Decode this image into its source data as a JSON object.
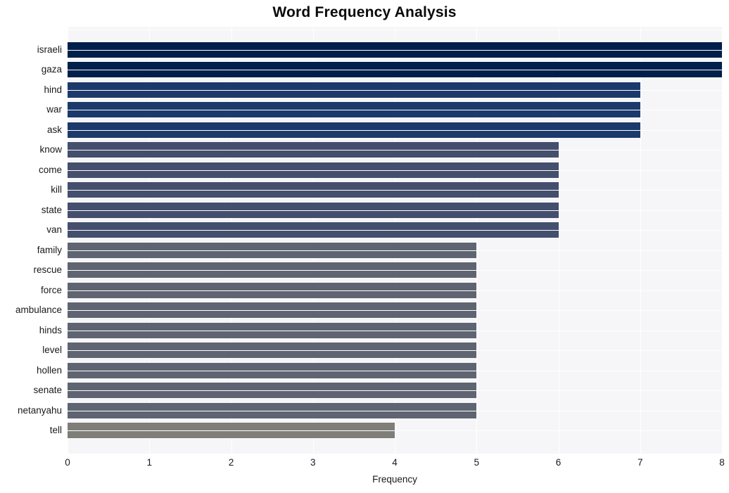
{
  "chart_data": {
    "type": "bar",
    "orientation": "horizontal",
    "title": "Word Frequency Analysis",
    "xlabel": "Frequency",
    "ylabel": "",
    "xlim": [
      0,
      8
    ],
    "xticks": [
      0,
      1,
      2,
      3,
      4,
      5,
      6,
      7,
      8
    ],
    "xticklabels": [
      "0",
      "1",
      "2",
      "3",
      "4",
      "5",
      "6",
      "7",
      "8"
    ],
    "grid": true,
    "legend": null,
    "categories": [
      "israeli",
      "gaza",
      "hind",
      "war",
      "ask",
      "know",
      "come",
      "kill",
      "state",
      "van",
      "family",
      "rescue",
      "force",
      "ambulance",
      "hinds",
      "level",
      "hollen",
      "senate",
      "netanyahu",
      "tell"
    ],
    "values": [
      8,
      8,
      7,
      7,
      7,
      6,
      6,
      6,
      6,
      6,
      5,
      5,
      5,
      5,
      5,
      5,
      5,
      5,
      5,
      4
    ],
    "bar_colors": [
      "#011f4b",
      "#011f4b",
      "#1b3a6b",
      "#1b3a6b",
      "#1b3a6b",
      "#444f6e",
      "#444f6e",
      "#444f6e",
      "#444f6e",
      "#444f6e",
      "#5f6472",
      "#5f6472",
      "#5f6472",
      "#5f6472",
      "#5f6472",
      "#5f6472",
      "#5f6472",
      "#5f6472",
      "#5f6472",
      "#7e7d77"
    ],
    "plot_background": "#f6f6f8",
    "grid_color": "#ffffff",
    "figure_background": "#ffffff"
  }
}
